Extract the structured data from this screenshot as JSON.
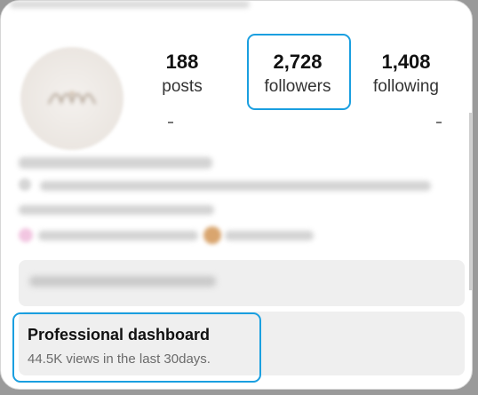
{
  "profile": {
    "avatar_icon": "profile-logo"
  },
  "stats": {
    "posts_count": "188",
    "posts_label": "posts",
    "followers_count": "2,728",
    "followers_label": "followers",
    "following_count": "1,408",
    "following_label": "following"
  },
  "dashboard": {
    "title": "Professional dashboard",
    "subtitle": "44.5K views in the last 30days."
  },
  "colors": {
    "highlight": "#1a9fe0",
    "panel": "#efefef"
  }
}
